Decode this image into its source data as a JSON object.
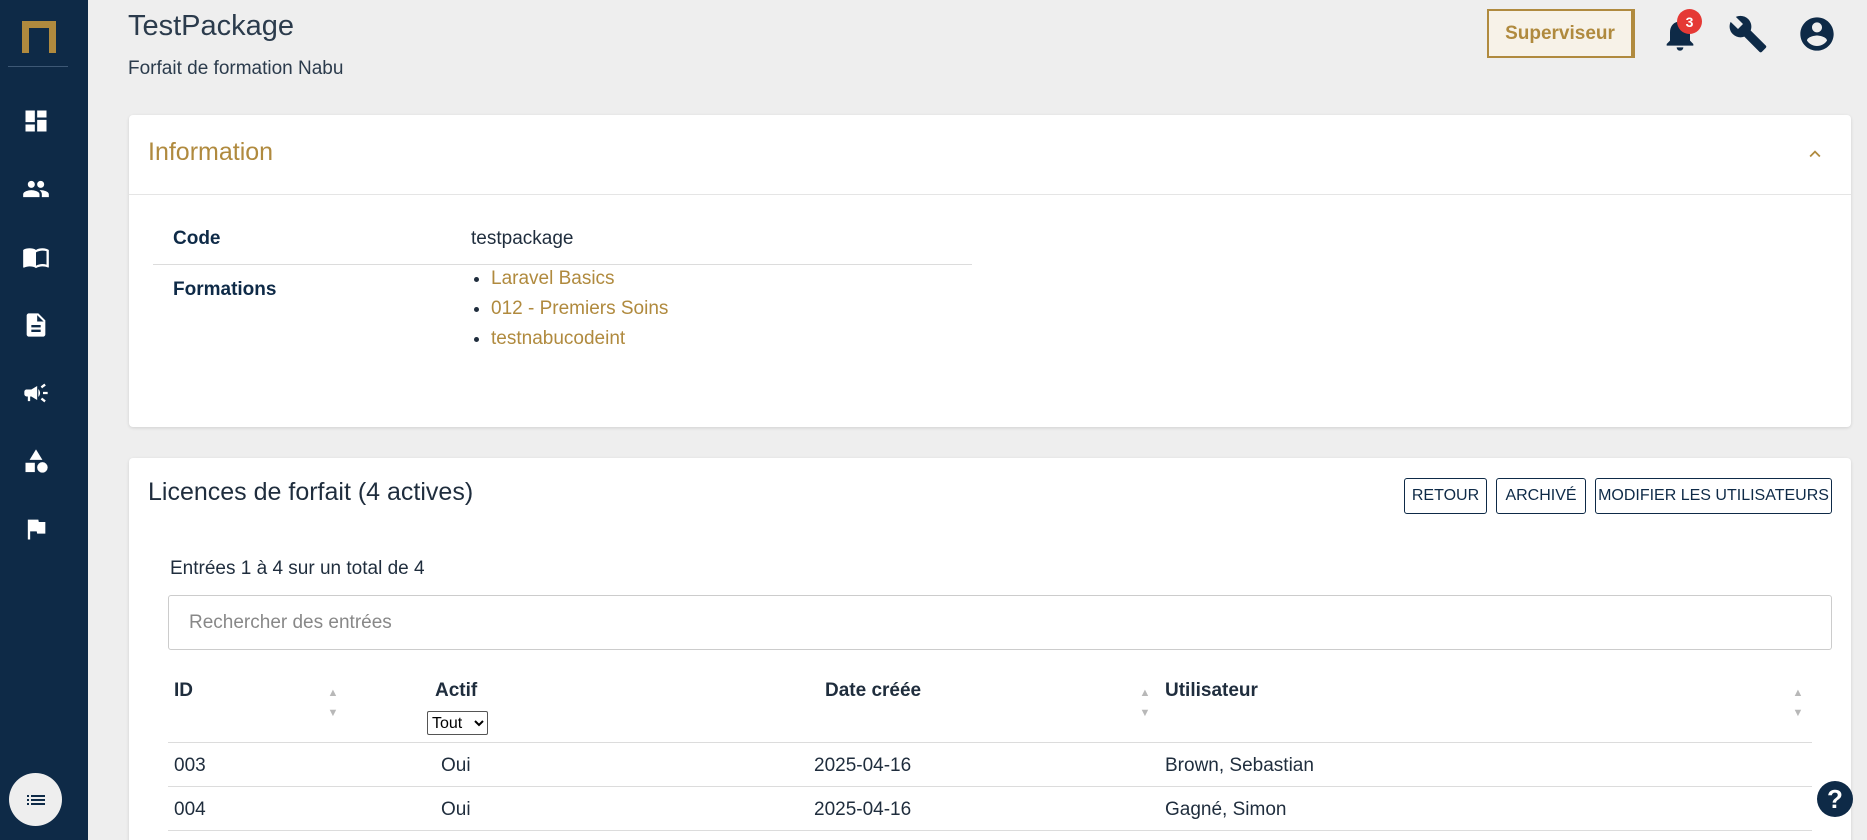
{
  "header": {
    "title": "TestPackage",
    "subtitle": "Forfait de formation Nabu",
    "supervisor_label": "Superviseur",
    "notification_count": "3"
  },
  "sidebar": {
    "items": [
      {
        "icon": "dashboard-icon"
      },
      {
        "icon": "users-icon"
      },
      {
        "icon": "book-icon"
      },
      {
        "icon": "document-icon"
      },
      {
        "icon": "megaphone-icon"
      },
      {
        "icon": "shapes-icon"
      },
      {
        "icon": "flag-icon"
      }
    ],
    "bottom_icon": "list-icon"
  },
  "info": {
    "title": "Information",
    "code_label": "Code",
    "code_value": "testpackage",
    "formations_label": "Formations",
    "formations": [
      "Laravel Basics",
      "012 - Premiers Soins",
      "testnabucodeint"
    ]
  },
  "licenses": {
    "title": "Licences de forfait (4 actives)",
    "buttons": {
      "back": "RETOUR",
      "archived": "ARCHIVÉ",
      "edit_users": "MODIFIER LES UTILISATEURS"
    },
    "entries_text": "Entrées 1 à 4 sur un total de 4",
    "search_placeholder": "Rechercher des entrées",
    "columns": {
      "id": "ID",
      "active": "Actif",
      "date": "Date créée",
      "user": "Utilisateur"
    },
    "active_filter": {
      "selected": "Tout"
    },
    "rows": [
      {
        "id": "003",
        "active": "Oui",
        "date": "2025-04-16",
        "user": "Brown, Sebastian"
      },
      {
        "id": "004",
        "active": "Oui",
        "date": "2025-04-16",
        "user": "Gagné, Simon"
      }
    ]
  },
  "help": {
    "label": "?"
  },
  "colors": {
    "accent": "#b08a3e",
    "sidebar": "#0e2a47",
    "badge": "#e53935"
  }
}
